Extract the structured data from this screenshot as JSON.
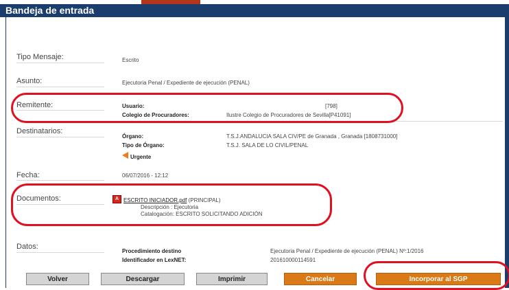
{
  "window": {
    "title": "Bandeja de entrada"
  },
  "fields": {
    "tipo_mensaje": {
      "label": "Tipo Mensaje:",
      "value": "Escrito"
    },
    "asunto": {
      "label": "Asunto:",
      "value": "Ejecutoria Penal / Expediente de ejecución (PENAL)"
    },
    "remitente": {
      "label": "Remitente:",
      "usuario_label": "Usuario:",
      "usuario_value": "[798]",
      "colegio_label": "Colegio de Procuradores:",
      "colegio_value": "Ilustre Colegio de Procuradores de Sevilla[P41091]"
    },
    "destinatarios": {
      "label": "Destinatarios:",
      "organo_label": "Órgano:",
      "organo_value": "T.S.J.ANDALUCIA SALA CIV/PE de Granada , Granada [1808731000]",
      "tipo_organo_label": "Tipo de Órgano:",
      "tipo_organo_value": "T.S.J. SALA DE LO CIVIL/PENAL",
      "urgente": "Urgente"
    },
    "fecha": {
      "label": "Fecha:",
      "value": "06/07/2016 - 12:12"
    },
    "documentos": {
      "label": "Documentos:",
      "file_name": "ESCRITO INICIADOR.pdf",
      "file_role": "(PRINCIPAL)",
      "descripcion": "Descripción : Ejecutoria",
      "catalogacion": "Catalogación: ESCRITO SOLICITANDO ADICIÓN"
    },
    "datos": {
      "label": "Datos:",
      "procedimiento_label": "Procedimiento destino",
      "procedimiento_value": "Ejecutoria Penal / Expediente de ejecución (PENAL)  Nº:1/2016",
      "lexnet_label": "Identificador en LexNET:",
      "lexnet_value": "201610000114591"
    }
  },
  "buttons": {
    "volver": "Volver",
    "descargar": "Descargar",
    "imprimir": "Imprimir",
    "cancelar": "Cancelar",
    "incorporar": "Incorporar al SGP"
  },
  "colors": {
    "titlebar": "#1a3d6e",
    "accent_orange": "#d97a16",
    "highlight_red": "#e01020"
  }
}
